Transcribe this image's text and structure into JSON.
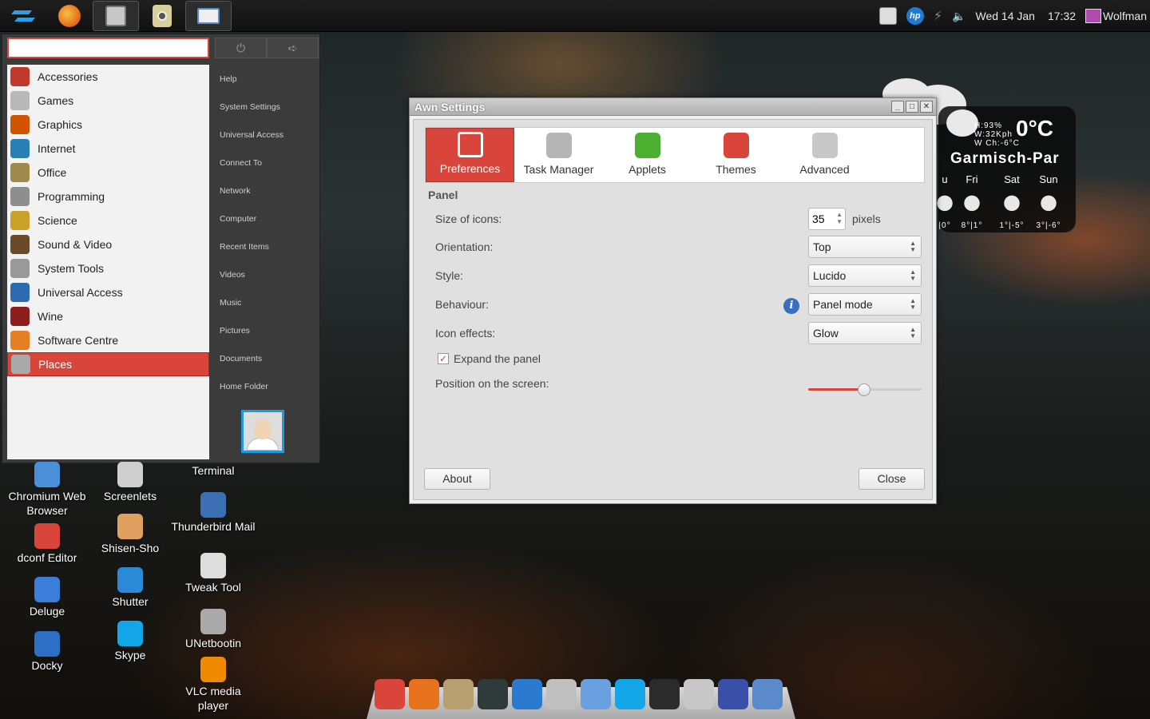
{
  "top_panel": {
    "launchers": [
      {
        "name": "zorin-menu-icon",
        "color": "#2aa0e8"
      },
      {
        "name": "firefox-icon",
        "color": "#e8731e"
      },
      {
        "name": "file-manager-icon",
        "color": "#c7c7c7"
      },
      {
        "name": "audio-player-icon",
        "color": "#c8b872"
      },
      {
        "name": "awn-settings-icon",
        "color": "#5a8acb"
      }
    ],
    "date": "Wed 14 Jan",
    "time": "17:32",
    "user": "Wolfman"
  },
  "menu": {
    "search_value": "",
    "categories": [
      {
        "label": "Accessories",
        "icon": "accessories-icon",
        "color": "#c0392b"
      },
      {
        "label": "Games",
        "icon": "games-icon",
        "color": "#b8b8b8"
      },
      {
        "label": "Graphics",
        "icon": "graphics-icon",
        "color": "#d35400"
      },
      {
        "label": "Internet",
        "icon": "internet-icon",
        "color": "#2980b9"
      },
      {
        "label": "Office",
        "icon": "office-icon",
        "color": "#a0894a"
      },
      {
        "label": "Programming",
        "icon": "programming-icon",
        "color": "#8e8e8e"
      },
      {
        "label": "Science",
        "icon": "science-icon",
        "color": "#c9a227"
      },
      {
        "label": "Sound & Video",
        "icon": "sound-video-icon",
        "color": "#6b4a2a"
      },
      {
        "label": "System Tools",
        "icon": "system-tools-icon",
        "color": "#9a9a9a"
      },
      {
        "label": "Universal Access",
        "icon": "universal-access-icon",
        "color": "#2b6cb0"
      },
      {
        "label": "Wine",
        "icon": "wine-icon",
        "color": "#8e1d1d"
      },
      {
        "label": "Software Centre",
        "icon": "software-centre-icon",
        "color": "#e67e22"
      },
      {
        "label": "Places",
        "icon": "places-icon",
        "color": "#aaaaaa"
      }
    ],
    "selected_category": "Places",
    "places": [
      "Help",
      "System Settings",
      "Universal Access",
      "Connect To",
      "Network",
      "Computer",
      "Recent Items",
      "Videos",
      "Music",
      "Pictures",
      "Documents",
      "Home Folder"
    ],
    "power_glyph": "⏻",
    "logout_glyph": "➪"
  },
  "desktop_icons": [
    {
      "label": "Chromium Web Browser",
      "icon": "chromium-icon",
      "color": "#4a90d9"
    },
    {
      "label": "dconf Editor",
      "icon": "dconf-editor-icon",
      "color": "#d9453a"
    },
    {
      "label": "Deluge",
      "icon": "deluge-icon",
      "color": "#3b7dd8"
    },
    {
      "label": "Docky",
      "icon": "docky-icon",
      "color": "#2d6fc5"
    },
    {
      "label": "Screenlets",
      "icon": "screenlets-icon",
      "color": "#cfcfcf"
    },
    {
      "label": "Shisen-Sho",
      "icon": "shisen-sho-icon",
      "color": "#e0a060"
    },
    {
      "label": "Shutter",
      "icon": "shutter-icon",
      "color": "#2a8ad8"
    },
    {
      "label": "Skype",
      "icon": "skype-icon",
      "color": "#12a5e8"
    },
    {
      "label": "Terminal",
      "icon": "terminal-icon",
      "color": "#333333"
    },
    {
      "label": "Thunderbird Mail",
      "icon": "thunderbird-icon",
      "color": "#3d6fb5"
    },
    {
      "label": "Tweak Tool",
      "icon": "tweak-tool-icon",
      "color": "#dddddd"
    },
    {
      "label": "UNetbootin",
      "icon": "unetbootin-icon",
      "color": "#aaaaaa"
    },
    {
      "label": "VLC media player",
      "icon": "vlc-icon",
      "color": "#f08a00"
    }
  ],
  "weather": {
    "humidity": "H:93%",
    "wind": "W:32Kph",
    "wind_chill": "W Ch:-6°C",
    "temperature": "0°C",
    "city": "Garmisch-Par",
    "days": [
      {
        "name": "u",
        "range": "|0°"
      },
      {
        "name": "Fri",
        "range": "8°|1°"
      },
      {
        "name": "Sat",
        "range": "1°|-5°"
      },
      {
        "name": "Sun",
        "range": "3°|-6°"
      }
    ]
  },
  "awn": {
    "title": "Awn Settings",
    "tabs": [
      {
        "label": "Preferences",
        "icon": "preferences-icon",
        "color": "#ffffff",
        "active": true
      },
      {
        "label": "Task Manager",
        "icon": "task-manager-icon",
        "color": "#b5b5b5",
        "active": false
      },
      {
        "label": "Applets",
        "icon": "applets-icon",
        "color": "#4caf30",
        "active": false
      },
      {
        "label": "Themes",
        "icon": "themes-icon",
        "color": "#d9453a",
        "active": false
      },
      {
        "label": "Advanced",
        "icon": "advanced-icon",
        "color": "#c8c8c8",
        "active": false
      }
    ],
    "section": "Panel",
    "size_label": "Size of icons:",
    "size_value": "35",
    "size_unit": "pixels",
    "orientation_label": "Orientation:",
    "orientation_value": "Top",
    "style_label": "Style:",
    "style_value": "Lucido",
    "behaviour_label": "Behaviour:",
    "behaviour_value": "Panel mode",
    "effects_label": "Icon effects:",
    "effects_value": "Glow",
    "expand_label": "Expand the panel",
    "expand_checked": true,
    "position_label": "Position on the screen:",
    "position_fraction": 0.49,
    "about_label": "About",
    "close_label": "Close"
  },
  "dock": [
    {
      "name": "docky-anchor-icon",
      "color": "#d9453a"
    },
    {
      "name": "firefox-icon",
      "color": "#e8731e"
    },
    {
      "name": "downloads-folder-icon",
      "color": "#b79f6f"
    },
    {
      "name": "system-monitor-icon",
      "color": "#2f3a3a"
    },
    {
      "name": "shutter-icon",
      "color": "#2a7ad0"
    },
    {
      "name": "settings-tools-icon",
      "color": "#c0c0c0"
    },
    {
      "name": "chromium-icon",
      "color": "#6aa0e0"
    },
    {
      "name": "skype-icon",
      "color": "#12a5e8"
    },
    {
      "name": "terminal-icon",
      "color": "#2b2b2b"
    },
    {
      "name": "file-manager-icon",
      "color": "#c7c7c7"
    },
    {
      "name": "security-shield-icon",
      "color": "#3a4fa8"
    },
    {
      "name": "awn-settings-icon",
      "color": "#5a8acb"
    }
  ]
}
